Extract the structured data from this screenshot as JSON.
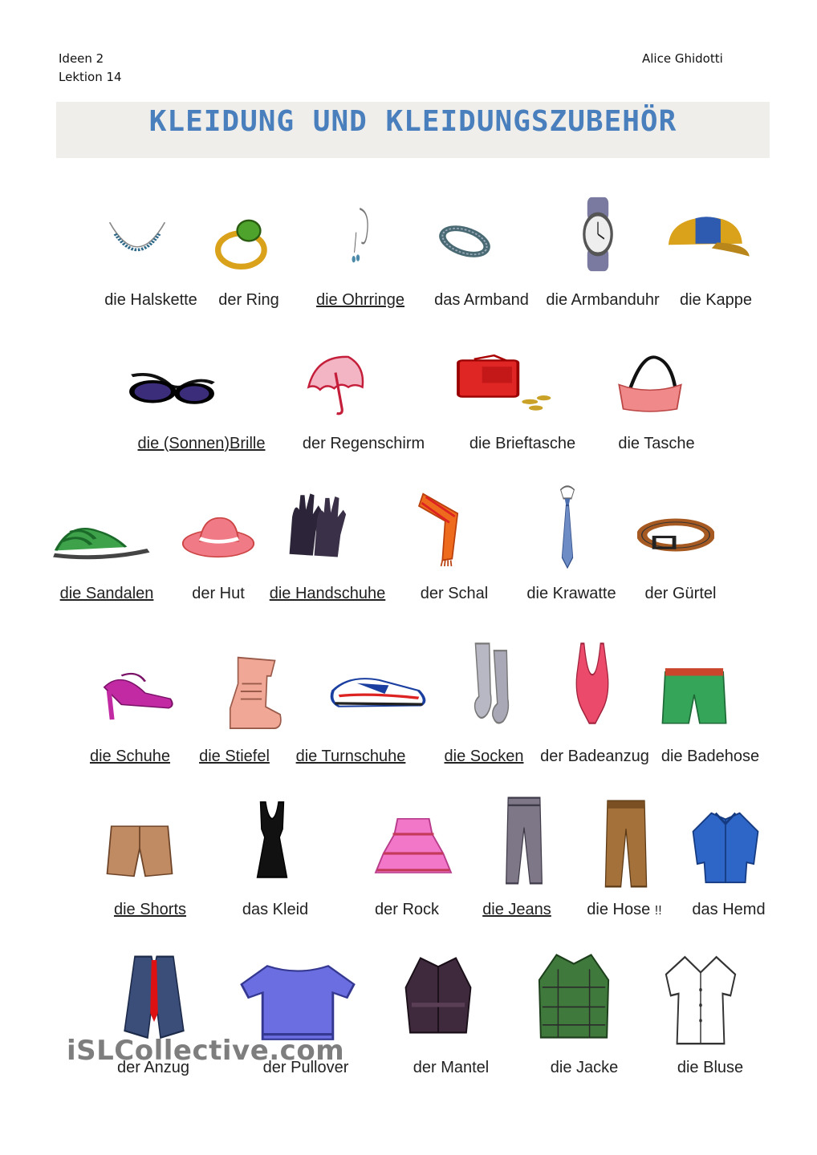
{
  "header": {
    "book": "Ideen 2",
    "lesson": "Lektion 14",
    "author": "Alice Ghidotti"
  },
  "title": "KLEIDUNG UND KLEIDUNGSZUBEHÖR",
  "items": [
    {
      "label": "die Halskette",
      "underline": false,
      "icon": "necklace-icon"
    },
    {
      "label": "der Ring",
      "underline": false,
      "icon": "ring-icon"
    },
    {
      "label": "die Ohrringe",
      "underline": true,
      "icon": "earrings-icon"
    },
    {
      "label": "das Armband",
      "underline": false,
      "icon": "bracelet-icon"
    },
    {
      "label": "die Armbanduhr",
      "underline": false,
      "icon": "wristwatch-icon"
    },
    {
      "label": "die Kappe",
      "underline": false,
      "icon": "cap-icon"
    },
    {
      "label": "die (Sonnen)Brille",
      "underline": true,
      "icon": "sunglasses-icon"
    },
    {
      "label": "der Regenschirm",
      "underline": false,
      "icon": "umbrella-icon"
    },
    {
      "label": "die Brieftasche",
      "underline": false,
      "icon": "wallet-icon"
    },
    {
      "label": "die Tasche",
      "underline": false,
      "icon": "handbag-icon"
    },
    {
      "label": "die Sandalen",
      "underline": true,
      "icon": "sandal-icon"
    },
    {
      "label": "der Hut",
      "underline": false,
      "icon": "hat-icon"
    },
    {
      "label": "die Handschuhe",
      "underline": true,
      "icon": "gloves-icon"
    },
    {
      "label": "der Schal",
      "underline": false,
      "icon": "scarf-icon"
    },
    {
      "label": "die Krawatte",
      "underline": false,
      "icon": "tie-icon"
    },
    {
      "label": "der Gürtel",
      "underline": false,
      "icon": "belt-icon"
    },
    {
      "label": "die Schuhe",
      "underline": true,
      "icon": "high-heel-shoe-icon"
    },
    {
      "label": "die Stiefel",
      "underline": true,
      "icon": "boot-icon"
    },
    {
      "label": "die Turnschuhe",
      "underline": true,
      "icon": "sneaker-icon"
    },
    {
      "label": "die Socken",
      "underline": true,
      "icon": "socks-icon"
    },
    {
      "label": "der Badeanzug",
      "underline": false,
      "icon": "swimsuit-icon"
    },
    {
      "label": "die Badehose",
      "underline": false,
      "icon": "swim-trunks-icon"
    },
    {
      "label": "die Shorts",
      "underline": true,
      "icon": "shorts-icon"
    },
    {
      "label": "das Kleid",
      "underline": false,
      "icon": "dress-icon"
    },
    {
      "label": "der Rock",
      "underline": false,
      "icon": "skirt-icon"
    },
    {
      "label": "die Jeans",
      "underline": true,
      "icon": "jeans-icon"
    },
    {
      "label": "die Hose",
      "underline": false,
      "icon": "trousers-icon",
      "mark": "!!"
    },
    {
      "label": "das Hemd",
      "underline": false,
      "icon": "shirt-icon"
    },
    {
      "label": "der Anzug",
      "underline": false,
      "icon": "suit-icon"
    },
    {
      "label": "der Pullover",
      "underline": false,
      "icon": "pullover-icon"
    },
    {
      "label": "der Mantel",
      "underline": false,
      "icon": "coat-icon"
    },
    {
      "label": "die Jacke",
      "underline": false,
      "icon": "jacket-icon"
    },
    {
      "label": "die Bluse",
      "underline": false,
      "icon": "blouse-icon"
    }
  ],
  "watermark": "iSLCollective.com"
}
